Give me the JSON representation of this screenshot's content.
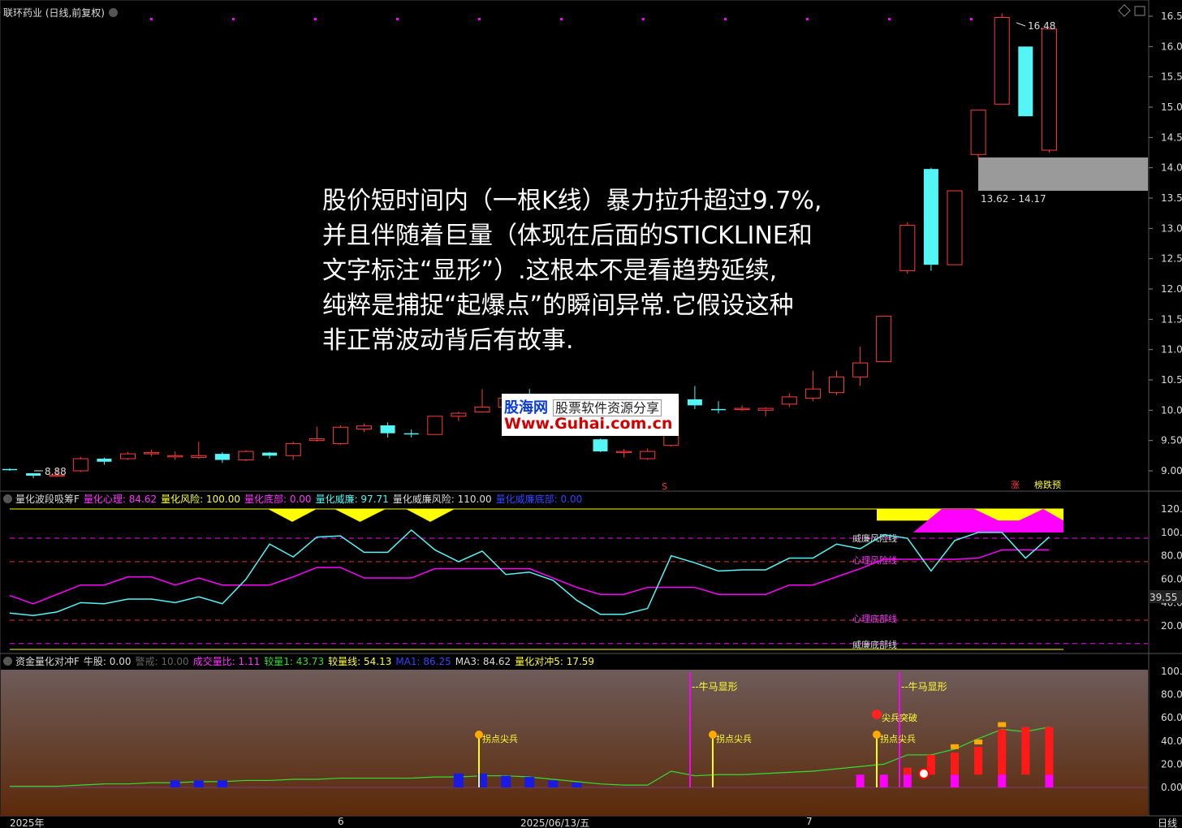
{
  "header": {
    "title": "联环药业 (日线,前复权)",
    "price_high_label": "16.48",
    "price_low_label": "8.88",
    "gap_label": "13.62 - 14.17",
    "bottom_flags": [
      "涨",
      "榜跌预"
    ],
    "s_marker": "S"
  },
  "colors": {
    "up": "#ff3b3b",
    "down": "#54f5f5",
    "magenta": "#ff00ff",
    "yellow": "#ffff00",
    "background": "#000000"
  },
  "annotation": {
    "lines": [
      "股价短时间内（一根K线）暴力拉升超过9.7%,",
      "并且伴随着巨量（体现在后面的STICKLINE和",
      "文字标注“显形”）.这根本不是看趋势延续,",
      "纯粹是捕捉“起爆点”的瞬间异常.它假设这种",
      "非正常波动背后有故事."
    ]
  },
  "watermark": {
    "line1": "股海网",
    "line1_b": "股票软件资源分享",
    "line2": "Www.Guhai.com.cn"
  },
  "price_axis": [
    "16.50",
    "16.00",
    "15.50",
    "15.00",
    "14.50",
    "14.00",
    "13.50",
    "13.00",
    "12.50",
    "12.00",
    "11.50",
    "11.00",
    "10.50",
    "10.00",
    "9.50",
    "9.00"
  ],
  "panel2": {
    "items": [
      {
        "text": "量化波段吸筹F",
        "color": "#dddddd"
      },
      {
        "text": "量化心理: 84.62",
        "color": "#ff33ff"
      },
      {
        "text": "量化风险: 100.00",
        "color": "#ffff33"
      },
      {
        "text": "量化底部: 0.00",
        "color": "#ff33ff"
      },
      {
        "text": "量化威廉: 97.71",
        "color": "#54f5f5"
      },
      {
        "text": "量化威廉风险: 110.00",
        "color": "#dddddd"
      },
      {
        "text": "量化威廉底部: 0.00",
        "color": "#3344ff"
      }
    ],
    "axis": [
      "120.00",
      "100.00",
      "80.00",
      "60.00",
      "40.00",
      "20.00"
    ],
    "cursor_value": "39.55",
    "line_labels": {
      "wr_risk": "威廉风险线",
      "psy_risk": "心理风险线",
      "psy_bottom": "心理底部线",
      "wr_bottom": "威廉底部线"
    }
  },
  "panel3": {
    "items": [
      {
        "text": "资金量化对冲F",
        "color": "#dddddd"
      },
      {
        "text": "牛股: 0.00",
        "color": "#dddddd"
      },
      {
        "text": "警戒: 10.00",
        "color": "#666666"
      },
      {
        "text": "成交量比: 1.11",
        "color": "#ff33ff"
      },
      {
        "text": "较量1: 43.73",
        "color": "#33dd33"
      },
      {
        "text": "较量线: 54.13",
        "color": "#ffff33"
      },
      {
        "text": "MA1: 86.25",
        "color": "#3344ff"
      },
      {
        "text": "MA3: 84.62",
        "color": "#dddddd"
      },
      {
        "text": "量化对冲5: 17.59",
        "color": "#ffff33"
      }
    ],
    "axis": [
      "100.00",
      "80.00",
      "60.00",
      "40.00",
      "20.00",
      "0.00"
    ],
    "labels": {
      "bull": "--牛马显形",
      "turn": "拐点尖兵",
      "break": "尖兵突破"
    }
  },
  "x_axis": {
    "labels": [
      "2025年",
      "6",
      "2025/06/13/五",
      "7"
    ],
    "period": "日线"
  },
  "chart_data": {
    "type": "candlestick",
    "dates": [],
    "ohlc": [
      [
        9.03,
        9.04,
        9.01,
        9.0
      ],
      [
        8.96,
        8.96,
        8.92,
        8.88
      ],
      [
        8.92,
        9.03,
        8.93,
        8.9
      ],
      [
        9.0,
        9.23,
        9.2,
        8.98
      ],
      [
        9.2,
        9.22,
        9.15,
        9.1
      ],
      [
        9.2,
        9.31,
        9.28,
        9.18
      ],
      [
        9.28,
        9.35,
        9.3,
        9.24
      ],
      [
        9.25,
        9.32,
        9.25,
        9.18
      ],
      [
        9.22,
        9.48,
        9.25,
        9.2
      ],
      [
        9.28,
        9.31,
        9.18,
        9.13
      ],
      [
        9.18,
        9.34,
        9.32,
        9.16
      ],
      [
        9.3,
        9.31,
        9.25,
        9.2
      ],
      [
        9.25,
        9.48,
        9.45,
        9.18
      ],
      [
        9.5,
        9.73,
        9.53,
        9.48
      ],
      [
        9.45,
        9.75,
        9.72,
        9.43
      ],
      [
        9.69,
        9.78,
        9.74,
        9.64
      ],
      [
        9.75,
        9.8,
        9.62,
        9.55
      ],
      [
        9.62,
        9.68,
        9.6,
        9.55
      ],
      [
        9.6,
        9.9,
        9.9,
        9.6
      ],
      [
        9.9,
        9.98,
        9.95,
        9.82
      ],
      [
        9.97,
        10.35,
        10.05,
        9.96
      ],
      [
        10.05,
        10.22,
        10.2,
        9.98
      ],
      [
        10.2,
        10.35,
        10.1,
        10.0
      ],
      [
        10.05,
        10.1,
        10.1,
        10.0
      ],
      [
        9.9,
        9.95,
        9.8,
        9.7
      ],
      [
        9.52,
        9.53,
        9.32,
        9.31
      ],
      [
        9.3,
        9.36,
        9.32,
        9.22
      ],
      [
        9.2,
        9.37,
        9.32,
        9.18
      ],
      [
        9.42,
        10.2,
        10.2,
        9.4
      ],
      [
        10.18,
        10.4,
        10.08,
        10.02
      ],
      [
        10.02,
        10.15,
        10.01,
        9.95
      ],
      [
        10.03,
        10.08,
        10.03,
        9.99
      ],
      [
        10.0,
        10.05,
        10.03,
        9.9
      ],
      [
        10.1,
        10.28,
        10.22,
        10.05
      ],
      [
        10.2,
        10.65,
        10.35,
        10.15
      ],
      [
        10.29,
        10.65,
        10.55,
        10.25
      ],
      [
        10.55,
        11.05,
        10.78,
        10.4
      ],
      [
        10.8,
        11.55,
        11.55,
        10.8
      ],
      [
        12.3,
        13.1,
        13.05,
        12.25
      ],
      [
        13.98,
        14.0,
        12.4,
        12.3
      ],
      [
        12.4,
        13.62,
        13.62,
        12.4
      ],
      [
        14.22,
        14.95,
        14.95,
        14.15
      ],
      [
        15.05,
        16.55,
        16.48,
        15.05
      ],
      [
        16.0,
        16.0,
        14.85,
        14.85
      ],
      [
        14.29,
        16.3,
        16.29,
        14.25
      ]
    ],
    "wr_line": [
      31,
      29,
      32,
      40,
      39,
      43,
      43,
      40,
      45,
      39,
      60,
      90,
      79,
      96,
      97,
      83,
      83,
      102,
      85,
      75,
      84,
      64,
      66,
      59,
      42,
      30,
      30,
      35,
      80,
      74,
      67,
      68,
      68,
      78,
      78,
      90,
      86,
      98,
      95,
      67,
      93,
      100,
      100,
      78,
      96
    ],
    "psy_line": [
      46,
      39,
      47,
      55,
      55,
      62,
      62,
      55,
      61,
      55,
      55,
      55,
      62,
      70,
      70,
      61,
      61,
      61,
      69,
      69,
      69,
      69,
      69,
      61,
      53,
      47,
      47,
      53,
      53,
      53,
      47,
      47,
      47,
      55,
      55,
      62,
      69,
      77,
      77,
      77,
      77,
      78,
      85,
      85,
      85
    ],
    "p3_line": [
      1,
      1,
      1,
      2,
      3,
      3,
      4,
      4,
      5,
      5,
      6,
      6,
      7,
      7,
      8,
      8,
      8,
      8,
      9,
      9,
      10,
      10,
      9,
      7,
      5,
      3,
      2,
      2,
      14,
      10,
      11,
      11,
      12,
      13,
      14,
      16,
      18,
      20,
      28,
      28,
      33,
      42,
      50,
      48,
      52
    ]
  }
}
